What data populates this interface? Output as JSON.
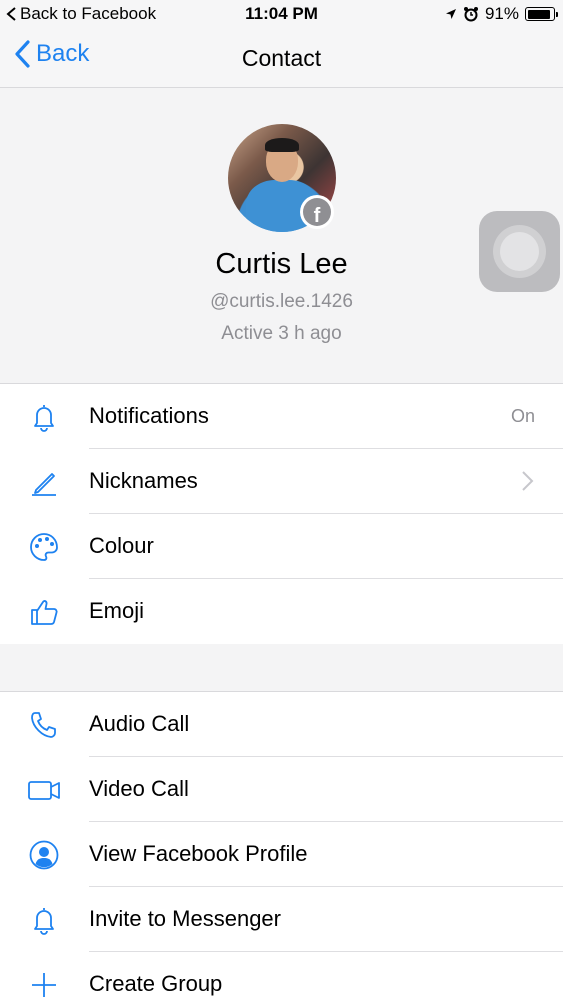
{
  "status_bar": {
    "back_to_app": "Back to Facebook",
    "time": "11:04 PM",
    "battery": "91%",
    "battery_level": 0.91
  },
  "nav": {
    "back_label": "Back",
    "title": "Contact"
  },
  "profile": {
    "name": "Curtis Lee",
    "handle": "@curtis.lee.1426",
    "status": "Active 3 h ago"
  },
  "settings": [
    {
      "label": "Notifications",
      "detail": "On",
      "icon": "bell-icon"
    },
    {
      "label": "Nicknames",
      "icon": "pencil-icon"
    },
    {
      "label": "Colour",
      "icon": "palette-icon"
    },
    {
      "label": "Emoji",
      "icon": "thumbs-up-icon"
    }
  ],
  "actions": [
    {
      "label": "Audio Call",
      "icon": "phone-icon"
    },
    {
      "label": "Video Call",
      "icon": "video-camera-icon"
    },
    {
      "label": "View Facebook Profile",
      "icon": "profile-icon"
    },
    {
      "label": "Invite to Messenger",
      "icon": "bell-icon"
    },
    {
      "label": "Create Group",
      "icon": "plus-icon"
    }
  ],
  "colors": {
    "accent": "#1e82f0",
    "secondary_text": "#8e8e93",
    "background": "#f4f4f5"
  }
}
